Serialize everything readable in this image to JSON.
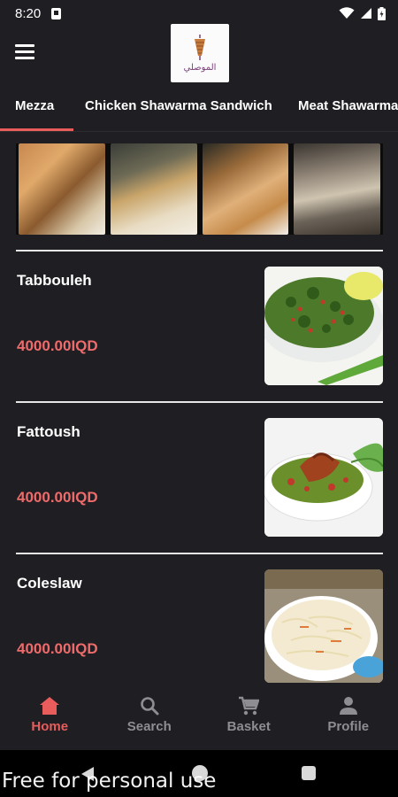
{
  "status": {
    "time": "8:20",
    "icons": [
      "sim-icon",
      "wifi-icon",
      "signal-icon",
      "battery-icon"
    ]
  },
  "header": {
    "logo_text": "الموصلي",
    "menu_icon": "hamburger-menu-icon"
  },
  "tabs": [
    {
      "label": "Mezza",
      "active": true
    },
    {
      "label": "Chicken Shawarma Sandwich",
      "active": false
    },
    {
      "label": "Meat Shawarma",
      "active": false
    }
  ],
  "menu_items": [
    {
      "name": "Tabbouleh",
      "price": "4000.00IQD"
    },
    {
      "name": "Fattoush",
      "price": "4000.00IQD"
    },
    {
      "name": "Coleslaw",
      "price": "4000.00IQD"
    }
  ],
  "bottom_nav": [
    {
      "label": "Home",
      "icon": "home-icon",
      "active": true
    },
    {
      "label": "Search",
      "icon": "search-icon",
      "active": false
    },
    {
      "label": "Basket",
      "icon": "cart-icon",
      "active": false
    },
    {
      "label": "Profile",
      "icon": "person-icon",
      "active": false
    }
  ],
  "watermark": "Free for personal use",
  "colors": {
    "background": "#1f1f23",
    "accent": "#e85c5c",
    "price": "#ef6b6b",
    "inactive": "#8d8d92"
  }
}
